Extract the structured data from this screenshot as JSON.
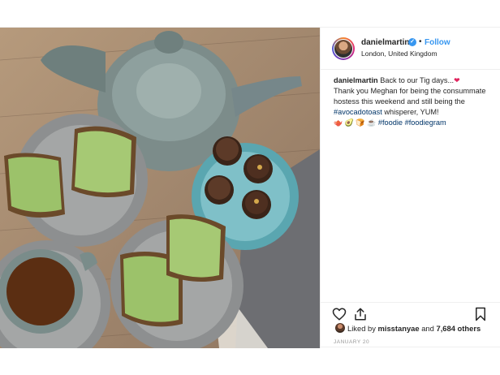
{
  "post": {
    "username": "danielmartin",
    "verified_icon": "verified-badge-icon",
    "follow_label": "Follow",
    "location": "London, United Kingdom",
    "caption": {
      "author": "danielmartin",
      "line1": "Back to our Tig days...",
      "line2": "Thank you Meghan for being the consummate hostess this weekend and still being the",
      "hashtag1": "#avocadotoast",
      "line3": "whisperer, YUM!",
      "emoji_row": "🫖 🥑 🍞 ☕",
      "hashtag2": "#foodie",
      "hashtag3": "#foodiegram"
    },
    "likes": {
      "prefix": "Liked by",
      "user": "misstanyae",
      "and": "and",
      "count": "7,684 others"
    },
    "date": "JANUARY 20"
  },
  "icons": {
    "like": "heart-icon",
    "share": "share-icon",
    "save": "bookmark-icon",
    "heart_emoji": "heart-emoji-icon"
  },
  "colors": {
    "follow": "#3897f0",
    "hashtag": "#003569",
    "date": "#999999"
  }
}
